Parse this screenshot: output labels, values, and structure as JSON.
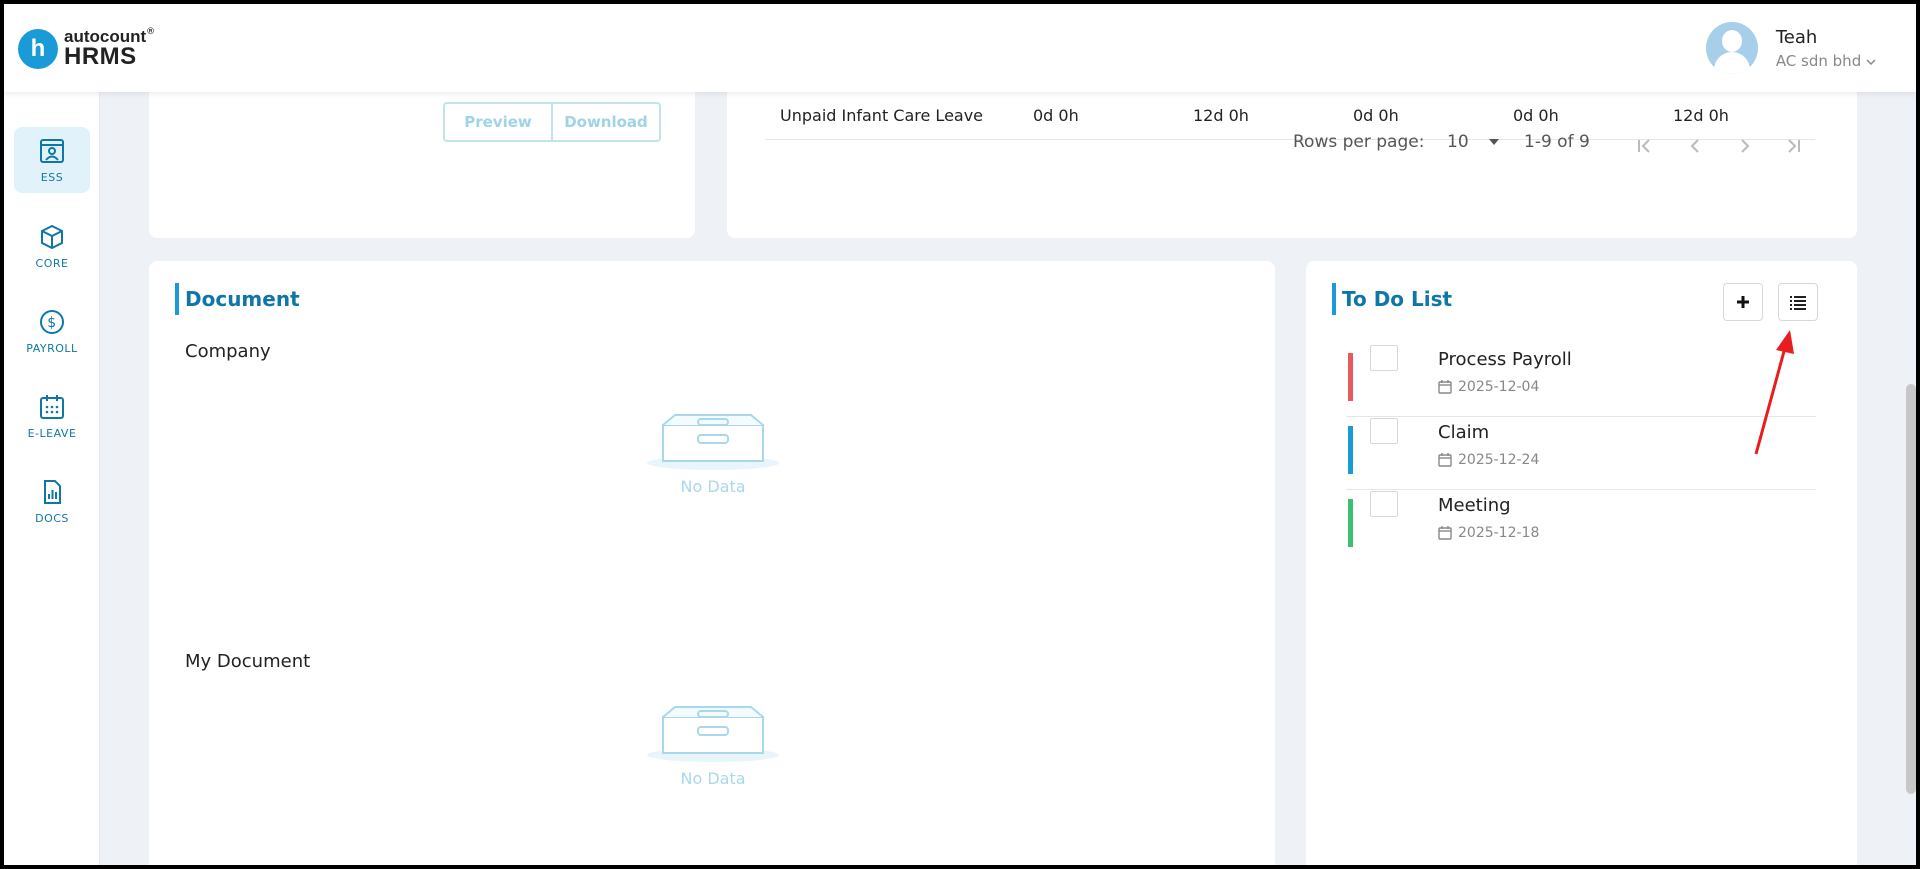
{
  "header": {
    "logo_small": "autocount",
    "logo_reg": "®",
    "logo_big": "HRMS",
    "user_name": "Teah",
    "user_company": "AC sdn bhd",
    "company_chevron": "chevron-down-icon"
  },
  "sidebar": {
    "items": [
      {
        "label": "ESS",
        "icon": "person-badge-icon",
        "active": true
      },
      {
        "label": "CORE",
        "icon": "cube-icon"
      },
      {
        "label": "PAYROLL",
        "icon": "dollar-icon"
      },
      {
        "label": "E-LEAVE",
        "icon": "calendar-icon"
      },
      {
        "label": "DOCS",
        "icon": "document-chart-icon"
      }
    ]
  },
  "payslip_card": {
    "preview_label": "Preview",
    "download_label": "Download"
  },
  "leave_card": {
    "row": {
      "type": "Unpaid Infant Care Leave",
      "values": [
        "0d 0h",
        "12d 0h",
        "0d 0h",
        "0d 0h",
        "12d 0h"
      ]
    },
    "rows_per_page_label": "Rows per page:",
    "rows_per_page_value": "10",
    "range_text": "1-9 of 9"
  },
  "document_card": {
    "title": "Document",
    "sections": [
      {
        "label": "Company",
        "empty_text": "No Data"
      },
      {
        "label": "My Document",
        "empty_text": "No Data"
      }
    ]
  },
  "todo_card": {
    "title": "To Do List",
    "add_icon": "plus-icon",
    "list_icon": "list-icon",
    "items": [
      {
        "name": "Process Payroll",
        "date": "2025-12-04",
        "color": "#e8585f"
      },
      {
        "name": "Claim",
        "date": "2025-12-24",
        "color": "#1a9bd7"
      },
      {
        "name": "Meeting",
        "date": "2025-12-18",
        "color": "#3cbf6e"
      }
    ]
  },
  "colors": {
    "accent": "#1a9bd7",
    "brand_text": "#0f77a8",
    "annotation_arrow": "#e81e1e"
  }
}
